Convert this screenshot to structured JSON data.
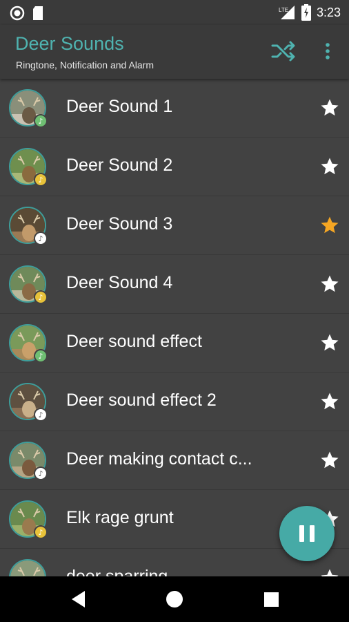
{
  "status": {
    "time": "3:23",
    "network": "LTE"
  },
  "app_bar": {
    "title": "Deer Sounds",
    "subtitle": "Ringtone, Notification and Alarm",
    "accent": "#4fb3b0"
  },
  "icons": {
    "shuffle": "shuffle-icon",
    "more": "more-vert-icon",
    "star": "star-icon",
    "music_note": "music-note-icon",
    "pause": "pause-icon",
    "back": "nav-back-icon",
    "home": "nav-home-icon",
    "recents": "nav-recents-icon"
  },
  "sounds": [
    {
      "label": "Deer Sound 1",
      "favorite": false,
      "badge": "green"
    },
    {
      "label": "Deer Sound 2",
      "favorite": false,
      "badge": "yellow"
    },
    {
      "label": "Deer Sound 3",
      "favorite": true,
      "badge": "white"
    },
    {
      "label": "Deer Sound 4",
      "favorite": false,
      "badge": "yellow"
    },
    {
      "label": "Deer sound effect",
      "favorite": false,
      "badge": "green"
    },
    {
      "label": "Deer sound effect 2",
      "favorite": false,
      "badge": "white"
    },
    {
      "label": "Deer making contact c...",
      "favorite": false,
      "badge": "white"
    },
    {
      "label": "Elk rage grunt",
      "favorite": false,
      "badge": "yellow"
    },
    {
      "label": "deer sparring",
      "favorite": false,
      "badge": "green"
    }
  ],
  "colors": {
    "star_active": "#f5a623",
    "star_inactive": "#ffffff",
    "fab": "#46aaa6",
    "badge_green": "#6fbf73",
    "badge_yellow": "#e8c23a",
    "badge_white": "#ffffff"
  }
}
